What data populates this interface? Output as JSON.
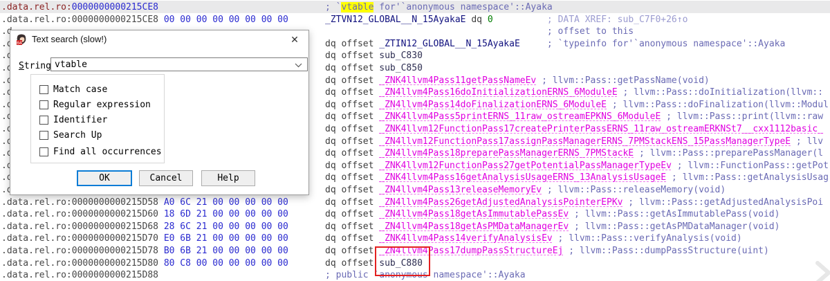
{
  "app": "disassembly-listing",
  "colors": {
    "search_match_highlight": "#ffff00",
    "annotation_box_red": "#e32020",
    "extern_symbol_magenta": "#e000e0",
    "public_symbol_navy": "#10107e",
    "comment_slate": "#6a6ab4",
    "xref_comment": "#9b9bd0",
    "byte_blue": "#2a2ad0",
    "current_line_prefix_maroon": "#8b2424",
    "current_line_band": "#e9e9ea",
    "focus_button_blue": "#0c7cd6",
    "literal_green": "#007d00"
  },
  "listing": {
    "left_rows": [
      {
        "current": true,
        "segments": [
          [
            "pfx",
            ".data.rel.ro:"
          ],
          [
            "num",
            "0000000000215CE8"
          ]
        ]
      },
      {
        "segments": [
          [
            "addr",
            ".data.rel.ro:0000000000215CE8 "
          ],
          [
            "byte",
            "00 00 00 00 00 00 00 00"
          ]
        ]
      },
      {
        "segments": [
          [
            "addr",
            ".d"
          ]
        ]
      },
      {
        "segments": [
          [
            "addr",
            ".d"
          ]
        ]
      },
      {
        "segments": [
          [
            "addr",
            ".d"
          ]
        ]
      },
      {
        "segments": [
          [
            "addr",
            ".d"
          ]
        ]
      },
      {
        "segments": [
          [
            "addr",
            ".d"
          ]
        ]
      },
      {
        "segments": [
          [
            "addr",
            ".d"
          ]
        ]
      },
      {
        "segments": [
          [
            "addr",
            ".d"
          ]
        ]
      },
      {
        "segments": [
          [
            "addr",
            ".d"
          ]
        ]
      },
      {
        "segments": [
          [
            "addr",
            ".d"
          ]
        ]
      },
      {
        "segments": [
          [
            "addr",
            ".d"
          ]
        ]
      },
      {
        "segments": [
          [
            "addr",
            ".d"
          ]
        ]
      },
      {
        "segments": [
          [
            "addr",
            ".d"
          ]
        ]
      },
      {
        "segments": [
          [
            "addr",
            ".d"
          ]
        ]
      },
      {
        "segments": [
          [
            "addr",
            ".data.rel.ro:0000000000215D50 "
          ],
          [
            "byte",
            "50 6C 21 00 00 00 00 00"
          ]
        ]
      },
      {
        "segments": [
          [
            "addr",
            ".data.rel.ro:0000000000215D58 "
          ],
          [
            "byte",
            "A0 6C 21 00 00 00 00 00"
          ]
        ]
      },
      {
        "segments": [
          [
            "addr",
            ".data.rel.ro:0000000000215D60 "
          ],
          [
            "byte",
            "18 6D 21 00 00 00 00 00"
          ]
        ]
      },
      {
        "segments": [
          [
            "addr",
            ".data.rel.ro:0000000000215D68 "
          ],
          [
            "byte",
            "28 6C 21 00 00 00 00 00"
          ]
        ]
      },
      {
        "segments": [
          [
            "addr",
            ".data.rel.ro:0000000000215D70 "
          ],
          [
            "byte",
            "E0 6B 21 00 00 00 00 00"
          ]
        ]
      },
      {
        "segments": [
          [
            "addr",
            ".data.rel.ro:0000000000215D78 "
          ],
          [
            "byte",
            "B0 6B 21 00 00 00 00 00"
          ]
        ]
      },
      {
        "segments": [
          [
            "addr",
            ".data.rel.ro:0000000000215D80 "
          ],
          [
            "byte",
            "80 C8 00 00 00 00 00 00"
          ]
        ]
      },
      {
        "segments": [
          [
            "addr",
            ".data.rel.ro:0000000000215D88"
          ]
        ]
      }
    ],
    "right_rows": [
      {
        "segments": [
          [
            "cmt",
            "; `"
          ],
          [
            "hl",
            "vtable"
          ],
          [
            "cmt",
            " for'`anonymous namespace'::Ayaka"
          ]
        ]
      },
      {
        "segments": [
          [
            "pub",
            "_ZTVN12_GLOBAL__N_15AyakaE"
          ],
          [
            "kw",
            " dq "
          ],
          [
            "lit",
            "0"
          ],
          [
            "sp",
            "          "
          ],
          [
            "xref",
            "; DATA XREF: sub_C7F0+26↑o"
          ]
        ]
      },
      {
        "segments": [
          [
            "sp",
            "                                         "
          ],
          [
            "cmt",
            "; offset to this"
          ]
        ]
      },
      {
        "segments": [
          [
            "kw",
            "dq offset "
          ],
          [
            "pub",
            "_ZTIN12_GLOBAL__N_15AyakaE"
          ],
          [
            "sp",
            "     "
          ],
          [
            "cmt",
            "; `typeinfo for'`anonymous namespace'::Ayaka"
          ]
        ]
      },
      {
        "segments": [
          [
            "kw",
            "dq offset "
          ],
          [
            "sub",
            "sub_C830"
          ]
        ]
      },
      {
        "segments": [
          [
            "kw",
            "dq offset "
          ],
          [
            "sub",
            "sub_C850"
          ]
        ]
      },
      {
        "segments": [
          [
            "kw",
            "dq offset "
          ],
          [
            "ext",
            "_ZNK4llvm4Pass11getPassNameEv"
          ],
          [
            "cmt",
            " ; llvm::Pass::getPassName(void)"
          ]
        ]
      },
      {
        "segments": [
          [
            "kw",
            "dq offset "
          ],
          [
            "ext",
            "_ZN4llvm4Pass16doInitializationERNS_6ModuleE"
          ],
          [
            "cmt",
            " ; llvm::Pass::doInitialization(llvm::"
          ]
        ]
      },
      {
        "segments": [
          [
            "kw",
            "dq offset "
          ],
          [
            "ext",
            "_ZN4llvm4Pass14doFinalizationERNS_6ModuleE"
          ],
          [
            "cmt",
            " ; llvm::Pass::doFinalization(llvm::Modul"
          ]
        ]
      },
      {
        "segments": [
          [
            "kw",
            "dq offset "
          ],
          [
            "ext",
            "_ZNK4llvm4Pass5printERNS_11raw_ostreamEPKNS_6ModuleE"
          ],
          [
            "cmt",
            " ; llvm::Pass::print(llvm::raw"
          ]
        ]
      },
      {
        "segments": [
          [
            "kw",
            "dq offset "
          ],
          [
            "ext",
            "_ZNK4llvm12FunctionPass17createPrinterPassERNS_11raw_ostreamERKNSt7__cxx1112basic_"
          ]
        ]
      },
      {
        "segments": [
          [
            "kw",
            "dq offset "
          ],
          [
            "ext",
            "_ZN4llvm12FunctionPass17assignPassManagerERNS_7PMStackENS_15PassManagerTypeE"
          ],
          [
            "cmt",
            " ; llv"
          ]
        ]
      },
      {
        "segments": [
          [
            "kw",
            "dq offset "
          ],
          [
            "ext",
            "_ZN4llvm4Pass18preparePassManagerERNS_7PMStackE"
          ],
          [
            "cmt",
            " ; llvm::Pass::preparePassManager(l"
          ]
        ]
      },
      {
        "segments": [
          [
            "kw",
            "dq offset "
          ],
          [
            "ext",
            "_ZNK4llvm12FunctionPass27getPotentialPassManagerTypeEv"
          ],
          [
            "cmt",
            " ; llvm::FunctionPass::getPot"
          ]
        ]
      },
      {
        "segments": [
          [
            "kw",
            "dq offset "
          ],
          [
            "ext",
            "_ZNK4llvm4Pass16getAnalysisUsageERNS_13AnalysisUsageE"
          ],
          [
            "cmt",
            " ; llvm::Pass::getAnalysisUsag"
          ]
        ]
      },
      {
        "segments": [
          [
            "kw",
            "dq offset "
          ],
          [
            "ext",
            "_ZN4llvm4Pass13releaseMemoryEv"
          ],
          [
            "cmt",
            " ; llvm::Pass::releaseMemory(void)"
          ]
        ]
      },
      {
        "segments": [
          [
            "kw",
            "dq offset "
          ],
          [
            "ext",
            "_ZN4llvm4Pass26getAdjustedAnalysisPointerEPKv"
          ],
          [
            "cmt",
            " ; llvm::Pass::getAdjustedAnalysisPoi"
          ]
        ]
      },
      {
        "segments": [
          [
            "kw",
            "dq offset "
          ],
          [
            "ext",
            "_ZN4llvm4Pass18getAsImmutablePassEv"
          ],
          [
            "cmt",
            " ; llvm::Pass::getAsImmutablePass(void)"
          ]
        ]
      },
      {
        "segments": [
          [
            "kw",
            "dq offset "
          ],
          [
            "ext",
            "_ZN4llvm4Pass18getAsPMDataManagerEv"
          ],
          [
            "cmt",
            " ; llvm::Pass::getAsPMDataManager(void)"
          ]
        ]
      },
      {
        "segments": [
          [
            "kw",
            "dq offset "
          ],
          [
            "ext",
            "_ZNK4llvm4Pass14verifyAnalysisEv"
          ],
          [
            "cmt",
            " ; llvm::Pass::verifyAnalysis(void)"
          ]
        ]
      },
      {
        "segments": [
          [
            "kw",
            "dq offset "
          ],
          [
            "ext",
            "_ZN4llvm4Pass17dumpPassStructureEj"
          ],
          [
            "cmt",
            " ; llvm::Pass::dumpPassStructure(uint)"
          ]
        ]
      },
      {
        "segments": [
          [
            "kw",
            "dq offset "
          ],
          [
            "sub",
            "sub_C880"
          ]
        ]
      },
      {
        "segments": [
          [
            "cmt",
            "; public `anonymous namespace'::Ayaka"
          ]
        ]
      }
    ]
  },
  "dialog": {
    "title": "Text search (slow!)",
    "close_glyph": "✕",
    "string_label_prefix": "S",
    "string_label_rest": "tring",
    "search_value": "vtable",
    "checkboxes": [
      {
        "label": "Match case",
        "checked": false
      },
      {
        "label": "Regular expression",
        "checked": false
      },
      {
        "label": "Identifier",
        "checked": false
      },
      {
        "label": "Search Up",
        "checked": false
      },
      {
        "label": "Find all occurrences",
        "checked": false
      }
    ],
    "buttons": {
      "ok": "OK",
      "cancel": "Cancel",
      "help": "Help"
    }
  }
}
